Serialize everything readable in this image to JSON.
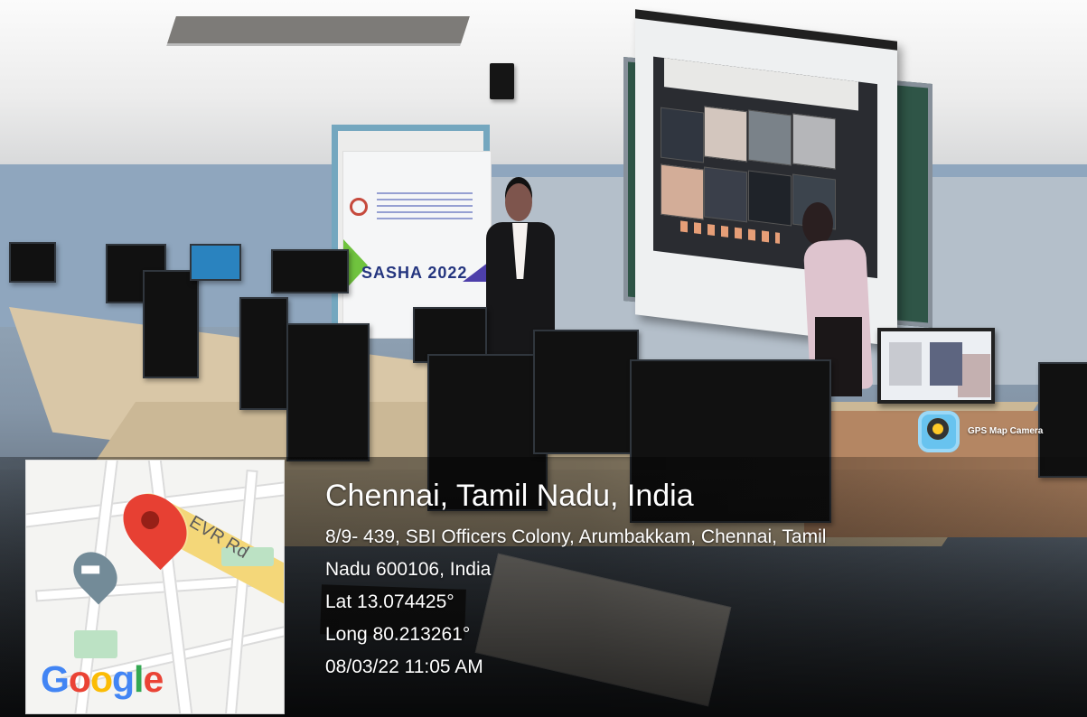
{
  "photo": {
    "banner_text": "SASHA 2022"
  },
  "gps_badge": {
    "label": "GPS Map Camera",
    "icon_name": "camera-lens-icon"
  },
  "map": {
    "road_label": "EVR Rd",
    "pin_icon": "location-pin-icon",
    "school_icon": "school-icon",
    "logo_letters": [
      "G",
      "o",
      "o",
      "g",
      "l",
      "e"
    ]
  },
  "location": {
    "title": "Chennai, Tamil Nadu, India",
    "address_line_1": "8/9- 439, SBI Officers Colony, Arumbakkam, Chennai, Tamil",
    "address_line_2": "Nadu 600106, India",
    "latitude": "Lat 13.074425°",
    "longitude": "Long 80.213261°",
    "datetime": "08/03/22 11:05 AM"
  },
  "colors": {
    "pin_red": "#e74033",
    "google_blue": "#4285f4",
    "google_red": "#ea4335",
    "google_yellow": "#fbbc05",
    "google_green": "#34a853"
  }
}
